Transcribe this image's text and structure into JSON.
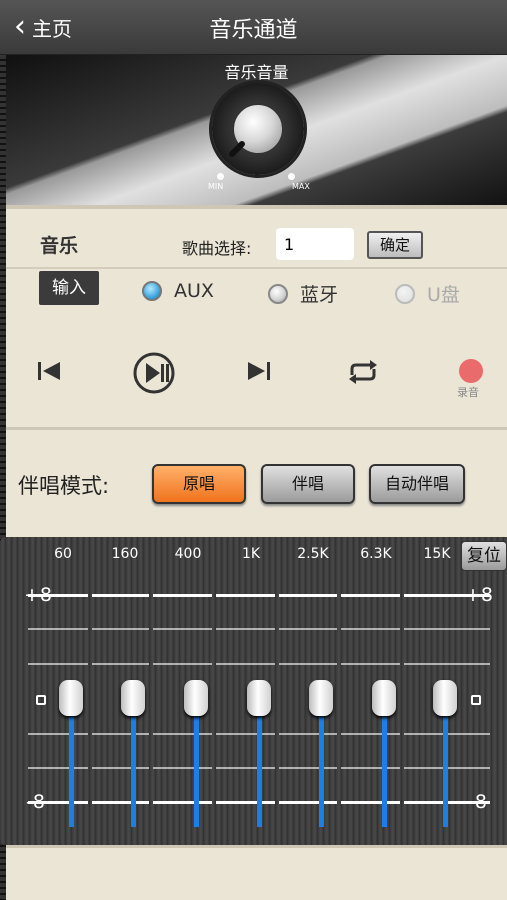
{
  "header": {
    "back_label": "主页",
    "title": "音乐通道"
  },
  "volume": {
    "label": "音乐音量",
    "min_label": "MIN",
    "max_label": "MAX"
  },
  "music": {
    "section_label": "音乐",
    "song_select_label": "歌曲选择:",
    "song_value": "1",
    "confirm_label": "确定",
    "input_label": "输入",
    "sources": [
      {
        "label": "AUX",
        "state": "selected"
      },
      {
        "label": "蓝牙",
        "state": "unselected"
      },
      {
        "label": "U盘",
        "state": "disabled"
      }
    ],
    "record_label": "录音"
  },
  "accompaniment": {
    "label": "伴唱模式:",
    "modes": [
      "原唱",
      "伴唱",
      "自动伴唱"
    ],
    "active_mode": "原唱"
  },
  "eq": {
    "reset_label": "复位",
    "bands": [
      "60",
      "160",
      "400",
      "1K",
      "2.5K",
      "6.3K",
      "15K"
    ],
    "levels": [
      0,
      0,
      0,
      0,
      0,
      0,
      0
    ],
    "scale_max": "+8",
    "scale_zero": "0",
    "scale_min": "-8",
    "accent_color": "#1e7ee8"
  }
}
